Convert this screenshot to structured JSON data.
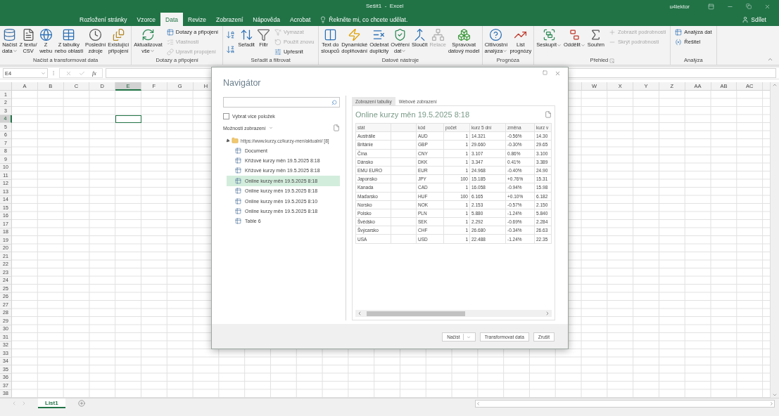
{
  "window": {
    "title": "Sešit1  -  Excel",
    "user": "u4lektor"
  },
  "ribbon_tabs": [
    {
      "label": "Rozložení stránky",
      "selected": false
    },
    {
      "label": "Vzorce",
      "selected": false
    },
    {
      "label": "Data",
      "selected": true
    },
    {
      "label": "Revize",
      "selected": false
    },
    {
      "label": "Zobrazení",
      "selected": false
    },
    {
      "label": "Nápověda",
      "selected": false
    },
    {
      "label": "Acrobat",
      "selected": false
    }
  ],
  "tell_me": "Řekněte mi, co chcete udělat.",
  "share": "Sdílet",
  "ribbon": [
    {
      "label": "Načíst a transformovat data",
      "launcher": false,
      "items": [
        {
          "kind": "large",
          "label": "Načíst\ndata",
          "dropdown": true,
          "disabled": false
        },
        {
          "kind": "large",
          "label": "Z textu/\nCSV",
          "dropdown": false,
          "disabled": false
        },
        {
          "kind": "large",
          "label": "Z\nwebu",
          "dropdown": false,
          "disabled": false
        },
        {
          "kind": "large",
          "label": "Z tabulky\nnebo oblasti",
          "dropdown": false,
          "disabled": false
        },
        {
          "kind": "large",
          "label": "Poslední\nzdroje",
          "dropdown": false,
          "disabled": false
        },
        {
          "kind": "large",
          "label": "Existující\npřipojení",
          "dropdown": false,
          "disabled": false
        }
      ]
    },
    {
      "label": "Dotazy a připojení",
      "launcher": false,
      "items": [
        {
          "kind": "large",
          "label": "Aktualizovat\nvše",
          "dropdown": true,
          "disabled": false
        },
        {
          "kind": "column",
          "items": [
            {
              "label": "Dotazy a připojení",
              "disabled": false
            },
            {
              "label": "Vlastnosti",
              "disabled": true
            },
            {
              "label": "Upravit propojení",
              "disabled": true
            }
          ]
        }
      ]
    },
    {
      "label": "Seřadit a filtrovat",
      "launcher": false,
      "items": [
        {
          "kind": "sort"
        },
        {
          "kind": "large",
          "label": "Seřadit",
          "dropdown": false,
          "disabled": false
        },
        {
          "kind": "large",
          "label": "Filtr",
          "dropdown": false,
          "disabled": false
        },
        {
          "kind": "column",
          "items": [
            {
              "label": "Vymazat",
              "disabled": true
            },
            {
              "label": "Použít znovu",
              "disabled": true
            },
            {
              "label": "Upřesnit",
              "disabled": false
            }
          ]
        }
      ]
    },
    {
      "label": "Datové nástroje",
      "launcher": false,
      "items": [
        {
          "kind": "large",
          "label": "Text do\nsloupců",
          "dropdown": false,
          "disabled": false
        },
        {
          "kind": "large",
          "label": "Dynamické\ndoplňování",
          "dropdown": false,
          "disabled": false
        },
        {
          "kind": "large",
          "label": "Odebrat\nduplicity",
          "dropdown": false,
          "disabled": false
        },
        {
          "kind": "large",
          "label": "Ověření\ndat",
          "dropdown": true,
          "disabled": false
        },
        {
          "kind": "large",
          "label": "Sloučit",
          "dropdown": false,
          "disabled": false
        },
        {
          "kind": "large",
          "label": "Relace",
          "dropdown": false,
          "disabled": true
        },
        {
          "kind": "large",
          "label": "Spravovat\ndatový model",
          "dropdown": false,
          "disabled": false
        }
      ]
    },
    {
      "label": "Prognóza",
      "launcher": false,
      "items": [
        {
          "kind": "large",
          "label": "Citlivostní\nanalýza",
          "dropdown": true,
          "disabled": false
        },
        {
          "kind": "large",
          "label": "List\nprognózy",
          "dropdown": false,
          "disabled": false
        }
      ]
    },
    {
      "label": "Přehled",
      "launcher": true,
      "items": [
        {
          "kind": "large",
          "label": "Seskupit",
          "dropdown": true,
          "disabled": false
        },
        {
          "kind": "large",
          "label": "Oddělit",
          "dropdown": true,
          "disabled": false
        },
        {
          "kind": "large",
          "label": "Souhrn",
          "dropdown": false,
          "disabled": false
        },
        {
          "kind": "column",
          "items": [
            {
              "label": "Zobrazit podrobnosti",
              "disabled": true
            },
            {
              "label": "Skrýt podrobnosti",
              "disabled": true
            }
          ]
        }
      ]
    },
    {
      "label": "Analýza",
      "launcher": false,
      "items": [
        {
          "kind": "column",
          "items": [
            {
              "label": "Analýza dat",
              "disabled": false
            },
            {
              "label": "Řešitel",
              "disabled": false
            }
          ]
        }
      ]
    }
  ],
  "formula_bar": {
    "name_box": "E4",
    "function_label": "fx"
  },
  "columns_left": [
    {
      "label": "A",
      "selected": false
    },
    {
      "label": "B",
      "selected": false
    },
    {
      "label": "C",
      "selected": false
    },
    {
      "label": "D",
      "selected": false
    },
    {
      "label": "E",
      "selected": true
    },
    {
      "label": "F",
      "selected": false
    },
    {
      "label": "G",
      "selected": false
    },
    {
      "label": "H",
      "selected": false
    }
  ],
  "columns_right": [
    {
      "label": "W",
      "selected": false
    },
    {
      "label": "X",
      "selected": false
    },
    {
      "label": "Y",
      "selected": false
    },
    {
      "label": "Z",
      "selected": false
    },
    {
      "label": "AA",
      "selected": false
    },
    {
      "label": "AB",
      "selected": false
    },
    {
      "label": "AC",
      "selected": false
    }
  ],
  "rows": [
    {
      "label": "1",
      "selected": false
    },
    {
      "label": "2",
      "selected": false
    },
    {
      "label": "3",
      "selected": false
    },
    {
      "label": "4",
      "selected": true
    },
    {
      "label": "5",
      "selected": false
    },
    {
      "label": "6",
      "selected": false
    },
    {
      "label": "7",
      "selected": false
    },
    {
      "label": "8",
      "selected": false
    },
    {
      "label": "9",
      "selected": false
    },
    {
      "label": "10",
      "selected": false
    },
    {
      "label": "11",
      "selected": false
    },
    {
      "label": "12",
      "selected": false
    },
    {
      "label": "13",
      "selected": false
    },
    {
      "label": "14",
      "selected": false
    },
    {
      "label": "15",
      "selected": false
    },
    {
      "label": "16",
      "selected": false
    },
    {
      "label": "17",
      "selected": false
    },
    {
      "label": "18",
      "selected": false
    },
    {
      "label": "19",
      "selected": false
    },
    {
      "label": "20",
      "selected": false
    },
    {
      "label": "21",
      "selected": false
    },
    {
      "label": "22",
      "selected": false
    },
    {
      "label": "23",
      "selected": false
    },
    {
      "label": "24",
      "selected": false
    },
    {
      "label": "25",
      "selected": false
    },
    {
      "label": "26",
      "selected": false
    },
    {
      "label": "27",
      "selected": false
    },
    {
      "label": "28",
      "selected": false
    },
    {
      "label": "29",
      "selected": false
    },
    {
      "label": "30",
      "selected": false
    },
    {
      "label": "31",
      "selected": false
    },
    {
      "label": "32",
      "selected": false
    },
    {
      "label": "33",
      "selected": false
    },
    {
      "label": "34",
      "selected": false
    },
    {
      "label": "35",
      "selected": false
    },
    {
      "label": "36",
      "selected": false
    },
    {
      "label": "37",
      "selected": false
    },
    {
      "label": "38",
      "selected": false
    }
  ],
  "sheets": [
    {
      "label": "List1",
      "selected": true
    }
  ],
  "navigator": {
    "title": "Navigátor",
    "multi_select": {
      "label": "Vybrat více položek",
      "checked": false
    },
    "display_options": "Možnosti zobrazení",
    "tree": {
      "label": "https://www.kurzy.cz/kurzy-men/aktualni/ [8]",
      "expanded": true,
      "children": [
        {
          "label": "Document",
          "selected": false
        },
        {
          "label": "Křížové kurzy měn 19.5.2025 8:18",
          "selected": false
        },
        {
          "label": "Křížové kurzy měn 19.5.2025 8:18",
          "selected": false
        },
        {
          "label": "Online kurzy měn 19.5.2025 8:18",
          "selected": true
        },
        {
          "label": "Online kurzy měn 19.5.2025 8:18",
          "selected": false
        },
        {
          "label": "Online kurzy měn 19.5.2025 8:10",
          "selected": false
        },
        {
          "label": "Online kurzy měn 19.5.2025 8:18",
          "selected": false
        },
        {
          "label": "Table 6",
          "selected": false
        }
      ]
    },
    "view_tabs": [
      {
        "label": "Zobrazení tabulky",
        "selected": true
      },
      {
        "label": "Webové zobrazení",
        "selected": false
      }
    ],
    "preview_title": "Online kurzy měn 19.5.2025 8:18",
    "columns": [
      "stát",
      "kód",
      "počet",
      "kurz 5 dní",
      "změna",
      "kurz v"
    ],
    "rows": [
      [
        "Austrálie",
        "AUD",
        "1",
        "14.321",
        "-0.56%",
        "14.30"
      ],
      [
        "Británie",
        "GBP",
        "1",
        "29.660",
        "-0.30%",
        "29.65"
      ],
      [
        "Čína",
        "CNY",
        "1",
        "3.107",
        "0.86%",
        "3.100"
      ],
      [
        "Dánsko",
        "DKK",
        "1",
        "3.347",
        "0.41%",
        "3.389"
      ],
      [
        "EMU EURO",
        "EUR",
        "1",
        "24.968",
        "-0.40%",
        "24.90"
      ],
      [
        "Japonsko",
        "JPY",
        "100",
        "15.185",
        "+0.76%",
        "15.31"
      ],
      [
        "Kanada",
        "CAD",
        "1",
        "16.058",
        "-0.94%",
        "15.98"
      ],
      [
        "Maďarsko",
        "HUF",
        "100",
        "6.165",
        "+0.10%",
        "6.182"
      ],
      [
        "Norsko",
        "NOK",
        "1",
        "2.153",
        "-0.57%",
        "2.150"
      ],
      [
        "Polsko",
        "PLN",
        "1",
        "5.880",
        "-1.24%",
        "5.840"
      ],
      [
        "Švédsko",
        "SEK",
        "1",
        "2.292",
        "-0.69%",
        "2.284"
      ],
      [
        "Švýcarsko",
        "CHF",
        "1",
        "26.680",
        "-0.34%",
        "26.63"
      ],
      [
        "USA",
        "USD",
        "1",
        "22.488",
        "-1.24%",
        "22.35"
      ]
    ],
    "buttons": [
      {
        "kind": "split",
        "label": "Načíst"
      },
      {
        "kind": "plain",
        "label": "Transformovat data"
      },
      {
        "kind": "plain",
        "label": "Zrušit"
      }
    ]
  }
}
